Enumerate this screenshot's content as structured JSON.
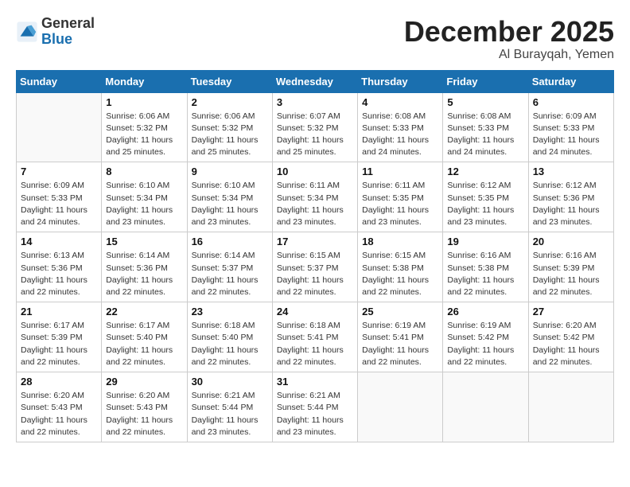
{
  "header": {
    "logo_line1": "General",
    "logo_line2": "Blue",
    "month_title": "December 2025",
    "location": "Al Burayqah, Yemen"
  },
  "weekdays": [
    "Sunday",
    "Monday",
    "Tuesday",
    "Wednesday",
    "Thursday",
    "Friday",
    "Saturday"
  ],
  "weeks": [
    [
      {
        "day": "",
        "sunrise": "",
        "sunset": "",
        "daylight": ""
      },
      {
        "day": "1",
        "sunrise": "6:06 AM",
        "sunset": "5:32 PM",
        "daylight": "11 hours and 25 minutes."
      },
      {
        "day": "2",
        "sunrise": "6:06 AM",
        "sunset": "5:32 PM",
        "daylight": "11 hours and 25 minutes."
      },
      {
        "day": "3",
        "sunrise": "6:07 AM",
        "sunset": "5:32 PM",
        "daylight": "11 hours and 25 minutes."
      },
      {
        "day": "4",
        "sunrise": "6:08 AM",
        "sunset": "5:33 PM",
        "daylight": "11 hours and 24 minutes."
      },
      {
        "day": "5",
        "sunrise": "6:08 AM",
        "sunset": "5:33 PM",
        "daylight": "11 hours and 24 minutes."
      },
      {
        "day": "6",
        "sunrise": "6:09 AM",
        "sunset": "5:33 PM",
        "daylight": "11 hours and 24 minutes."
      }
    ],
    [
      {
        "day": "7",
        "sunrise": "6:09 AM",
        "sunset": "5:33 PM",
        "daylight": "11 hours and 24 minutes."
      },
      {
        "day": "8",
        "sunrise": "6:10 AM",
        "sunset": "5:34 PM",
        "daylight": "11 hours and 23 minutes."
      },
      {
        "day": "9",
        "sunrise": "6:10 AM",
        "sunset": "5:34 PM",
        "daylight": "11 hours and 23 minutes."
      },
      {
        "day": "10",
        "sunrise": "6:11 AM",
        "sunset": "5:34 PM",
        "daylight": "11 hours and 23 minutes."
      },
      {
        "day": "11",
        "sunrise": "6:11 AM",
        "sunset": "5:35 PM",
        "daylight": "11 hours and 23 minutes."
      },
      {
        "day": "12",
        "sunrise": "6:12 AM",
        "sunset": "5:35 PM",
        "daylight": "11 hours and 23 minutes."
      },
      {
        "day": "13",
        "sunrise": "6:12 AM",
        "sunset": "5:36 PM",
        "daylight": "11 hours and 23 minutes."
      }
    ],
    [
      {
        "day": "14",
        "sunrise": "6:13 AM",
        "sunset": "5:36 PM",
        "daylight": "11 hours and 22 minutes."
      },
      {
        "day": "15",
        "sunrise": "6:14 AM",
        "sunset": "5:36 PM",
        "daylight": "11 hours and 22 minutes."
      },
      {
        "day": "16",
        "sunrise": "6:14 AM",
        "sunset": "5:37 PM",
        "daylight": "11 hours and 22 minutes."
      },
      {
        "day": "17",
        "sunrise": "6:15 AM",
        "sunset": "5:37 PM",
        "daylight": "11 hours and 22 minutes."
      },
      {
        "day": "18",
        "sunrise": "6:15 AM",
        "sunset": "5:38 PM",
        "daylight": "11 hours and 22 minutes."
      },
      {
        "day": "19",
        "sunrise": "6:16 AM",
        "sunset": "5:38 PM",
        "daylight": "11 hours and 22 minutes."
      },
      {
        "day": "20",
        "sunrise": "6:16 AM",
        "sunset": "5:39 PM",
        "daylight": "11 hours and 22 minutes."
      }
    ],
    [
      {
        "day": "21",
        "sunrise": "6:17 AM",
        "sunset": "5:39 PM",
        "daylight": "11 hours and 22 minutes."
      },
      {
        "day": "22",
        "sunrise": "6:17 AM",
        "sunset": "5:40 PM",
        "daylight": "11 hours and 22 minutes."
      },
      {
        "day": "23",
        "sunrise": "6:18 AM",
        "sunset": "5:40 PM",
        "daylight": "11 hours and 22 minutes."
      },
      {
        "day": "24",
        "sunrise": "6:18 AM",
        "sunset": "5:41 PM",
        "daylight": "11 hours and 22 minutes."
      },
      {
        "day": "25",
        "sunrise": "6:19 AM",
        "sunset": "5:41 PM",
        "daylight": "11 hours and 22 minutes."
      },
      {
        "day": "26",
        "sunrise": "6:19 AM",
        "sunset": "5:42 PM",
        "daylight": "11 hours and 22 minutes."
      },
      {
        "day": "27",
        "sunrise": "6:20 AM",
        "sunset": "5:42 PM",
        "daylight": "11 hours and 22 minutes."
      }
    ],
    [
      {
        "day": "28",
        "sunrise": "6:20 AM",
        "sunset": "5:43 PM",
        "daylight": "11 hours and 22 minutes."
      },
      {
        "day": "29",
        "sunrise": "6:20 AM",
        "sunset": "5:43 PM",
        "daylight": "11 hours and 22 minutes."
      },
      {
        "day": "30",
        "sunrise": "6:21 AM",
        "sunset": "5:44 PM",
        "daylight": "11 hours and 23 minutes."
      },
      {
        "day": "31",
        "sunrise": "6:21 AM",
        "sunset": "5:44 PM",
        "daylight": "11 hours and 23 minutes."
      },
      {
        "day": "",
        "sunrise": "",
        "sunset": "",
        "daylight": ""
      },
      {
        "day": "",
        "sunrise": "",
        "sunset": "",
        "daylight": ""
      },
      {
        "day": "",
        "sunrise": "",
        "sunset": "",
        "daylight": ""
      }
    ]
  ]
}
